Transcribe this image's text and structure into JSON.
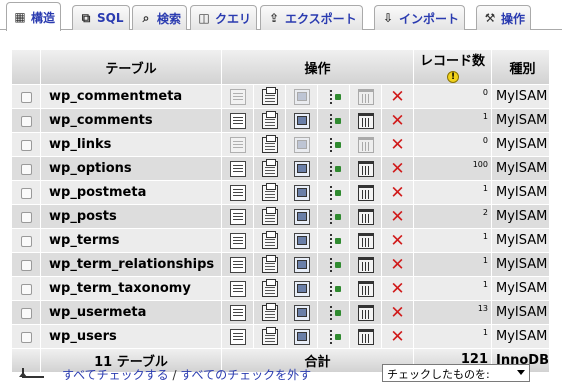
{
  "tabs": [
    {
      "label": "構造",
      "icon": "table-structure-icon",
      "active": true
    },
    {
      "label": "SQL",
      "icon": "sql-icon"
    },
    {
      "label": "検索",
      "icon": "search-icon"
    },
    {
      "label": "クエリ",
      "icon": "query-icon"
    },
    {
      "label": "エクスポート",
      "icon": "export-icon"
    },
    {
      "label": "インポート",
      "icon": "import-icon"
    },
    {
      "label": "操作",
      "icon": "wrench-icon"
    }
  ],
  "table": {
    "headers": {
      "table": "テーブル",
      "operations": "操作",
      "records": "レコード数",
      "type": "種別"
    },
    "rows": [
      {
        "name": "wp_commentmeta",
        "records": "0",
        "type": "MyISAM",
        "empty": true
      },
      {
        "name": "wp_comments",
        "records": "1",
        "type": "MyISAM",
        "empty": false
      },
      {
        "name": "wp_links",
        "records": "0",
        "type": "MyISAM",
        "empty": true
      },
      {
        "name": "wp_options",
        "records": "100",
        "type": "MyISAM",
        "empty": false
      },
      {
        "name": "wp_postmeta",
        "records": "1",
        "type": "MyISAM",
        "empty": false
      },
      {
        "name": "wp_posts",
        "records": "2",
        "type": "MyISAM",
        "empty": false
      },
      {
        "name": "wp_terms",
        "records": "1",
        "type": "MyISAM",
        "empty": false
      },
      {
        "name": "wp_term_relationships",
        "records": "1",
        "type": "MyISAM",
        "empty": false
      },
      {
        "name": "wp_term_taxonomy",
        "records": "1",
        "type": "MyISAM",
        "empty": false
      },
      {
        "name": "wp_usermeta",
        "records": "13",
        "type": "MyISAM",
        "empty": false
      },
      {
        "name": "wp_users",
        "records": "1",
        "type": "MyISAM",
        "empty": false
      }
    ],
    "footer": {
      "count": "11 テーブル",
      "total_label": "合計",
      "total_records": "121",
      "type": "InnoDB"
    }
  },
  "actions": {
    "check_all": "すべてチェックする",
    "separator": "/",
    "uncheck_all": "すべてのチェックを外す",
    "with_selected": "チェックしたものを:"
  }
}
